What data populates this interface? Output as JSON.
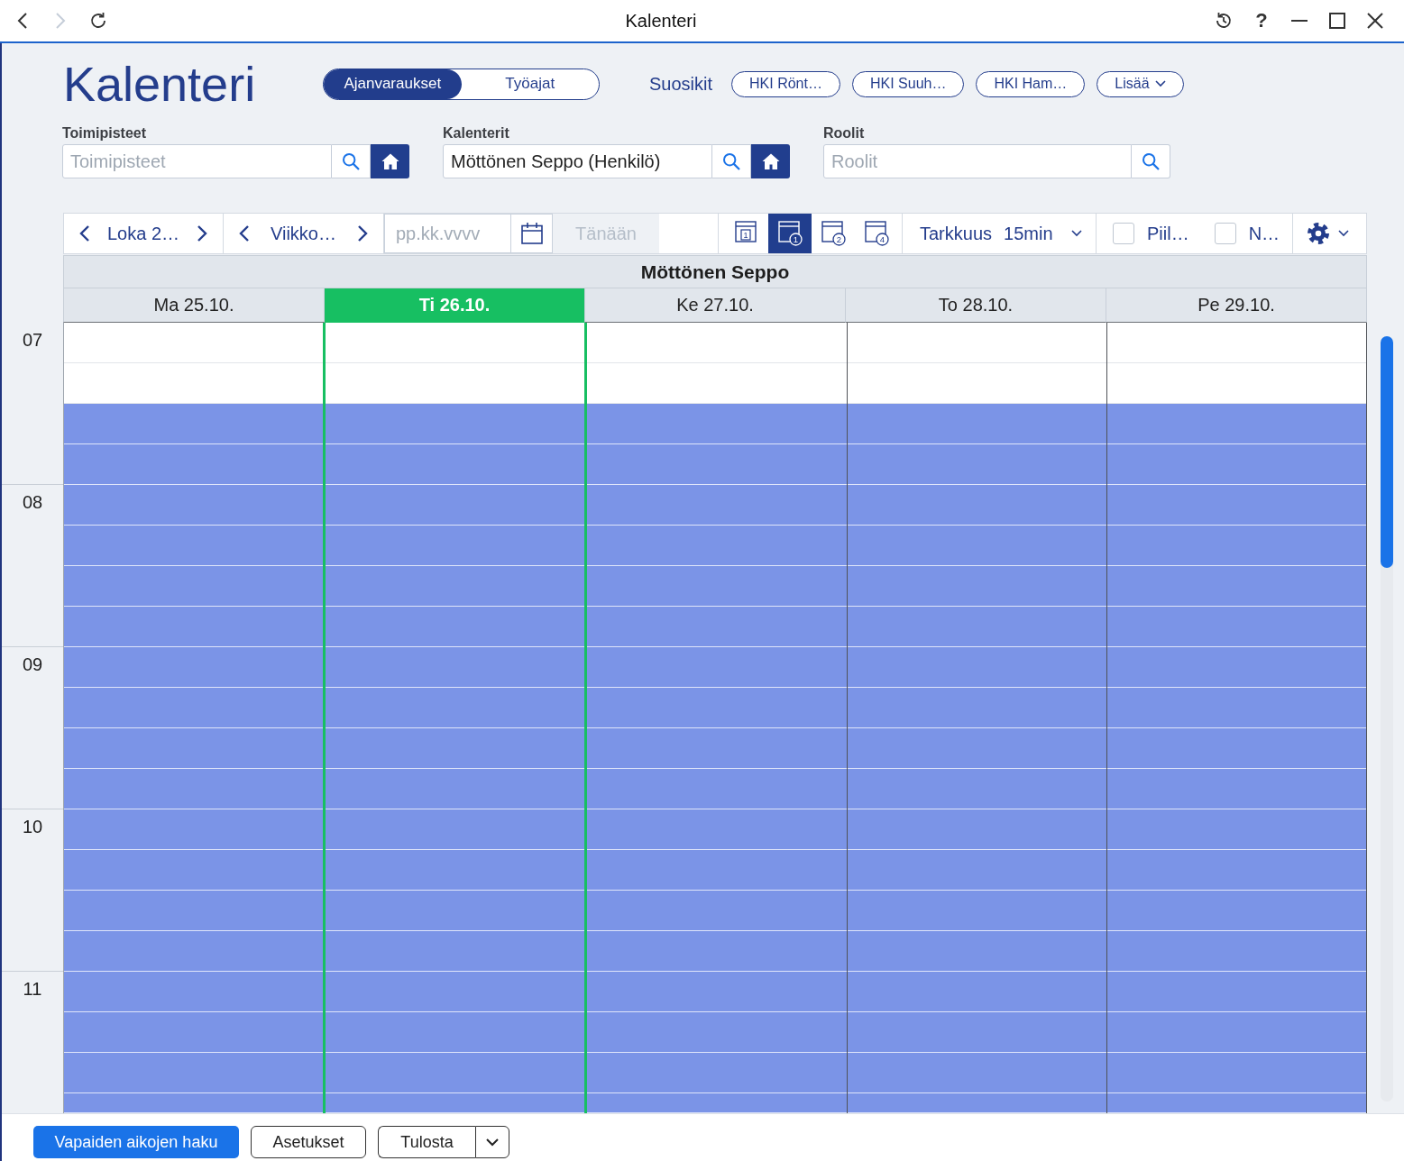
{
  "window": {
    "title": "Kalenteri",
    "nav": [
      {
        "kind": "back",
        "disabled": false
      },
      {
        "kind": "forward",
        "disabled": true
      },
      {
        "kind": "refresh",
        "disabled": false
      }
    ],
    "controls": [
      {
        "kind": "history"
      },
      {
        "kind": "help",
        "label": "?"
      },
      {
        "kind": "minimize"
      },
      {
        "kind": "maximize"
      },
      {
        "kind": "close"
      }
    ]
  },
  "header": {
    "title": "Kalenteri",
    "mode_tabs": [
      {
        "label": "Ajanvaraukset",
        "selected": true
      },
      {
        "label": "Työajat",
        "selected": false
      }
    ],
    "favorites_label": "Suosikit",
    "favorites": [
      "HKI Rönt…",
      "HKI Suuh…",
      "HKI Ham…"
    ],
    "more": "Lisää"
  },
  "filters": [
    {
      "label": "Toimipisteet",
      "placeholder": "Toimipisteet",
      "home": true
    },
    {
      "label": "Kalenterit",
      "value": "Möttönen Seppo (Henkilö)",
      "home": true
    },
    {
      "label": "Roolit",
      "placeholder": "Roolit",
      "home": false
    }
  ],
  "toolbar": {
    "month": "Loka 2…",
    "week": "Viikko…",
    "date": {
      "placeholder": "pp.kk.vvvv"
    },
    "today": {
      "label": "Tänään",
      "disabled": true
    },
    "views": [
      {
        "kind": "single",
        "number": "1",
        "selected": false
      },
      {
        "kind": "circled",
        "number": "1",
        "selected": true
      },
      {
        "kind": "circled",
        "number": "2",
        "selected": false
      },
      {
        "kind": "circled",
        "number": "4",
        "selected": false
      }
    ],
    "precision": {
      "label": "Tarkkuus",
      "value": "15min"
    },
    "checkboxes": [
      {
        "label": "Piil…",
        "checked": false
      },
      {
        "label": "N…",
        "checked": false
      }
    ]
  },
  "calendar": {
    "resource": "Möttönen Seppo",
    "days": [
      {
        "label": "Ma 25.10.",
        "selected": false
      },
      {
        "label": "Ti 26.10.",
        "selected": true
      },
      {
        "label": "Ke 27.10.",
        "selected": false
      },
      {
        "label": "To 28.10.",
        "selected": false
      },
      {
        "label": "Pe 29.10.",
        "selected": false
      }
    ],
    "hours": [
      "07",
      "08",
      "09",
      "10",
      "11"
    ],
    "slots": [
      {
        "kind": "free"
      },
      {
        "kind": "free"
      },
      {
        "kind": "work"
      },
      {
        "kind": "work"
      },
      {
        "kind": "work"
      },
      {
        "kind": "work"
      },
      {
        "kind": "work"
      },
      {
        "kind": "work"
      },
      {
        "kind": "work"
      },
      {
        "kind": "work"
      },
      {
        "kind": "work"
      },
      {
        "kind": "work"
      },
      {
        "kind": "work"
      },
      {
        "kind": "work"
      },
      {
        "kind": "work"
      },
      {
        "kind": "work"
      },
      {
        "kind": "work"
      },
      {
        "kind": "work"
      },
      {
        "kind": "work"
      },
      {
        "kind": "work"
      }
    ]
  },
  "actions": [
    {
      "label": "Vapaiden aikojen haku",
      "kind": "primary"
    },
    {
      "label": "Asetukset",
      "kind": "outline"
    },
    {
      "label": "Tulosta",
      "kind": "split"
    }
  ]
}
